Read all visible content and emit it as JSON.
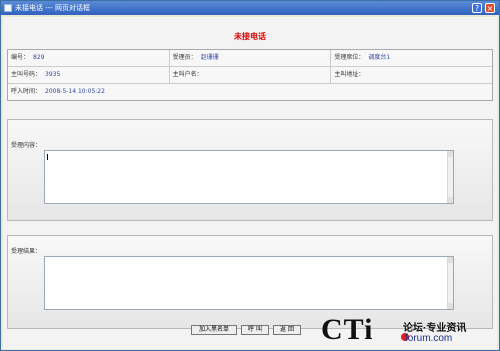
{
  "window": {
    "title": "未接电话 --- 网页对话框",
    "help_glyph": "?",
    "close_glyph": "×"
  },
  "heading": "未接电话",
  "fields": {
    "id_label": "编号：",
    "id_value": "829",
    "operator_label": "受理员：",
    "operator_value": "赵珊珊",
    "seat_label": "受理席位：",
    "seat_value": "调度台1",
    "caller_label": "主叫号码：",
    "caller_value": "3935",
    "caller_name_label": "主叫户名：",
    "caller_name_value": "",
    "caller_addr_label": "主叫地址：",
    "caller_addr_value": "",
    "time_label": "呼入时间：",
    "time_value": "2008-5-14 10:05:22"
  },
  "content_panel": {
    "label": "受理内容：",
    "value": ""
  },
  "result_panel": {
    "label": "受理结果：",
    "value": ""
  },
  "buttons": {
    "blacklist": "加入黑名单",
    "call": "呼 叫",
    "back": "返 回"
  },
  "watermark": {
    "logo": "CTi",
    "tagline": "论坛·专业资讯",
    "site": "forum.com"
  }
}
